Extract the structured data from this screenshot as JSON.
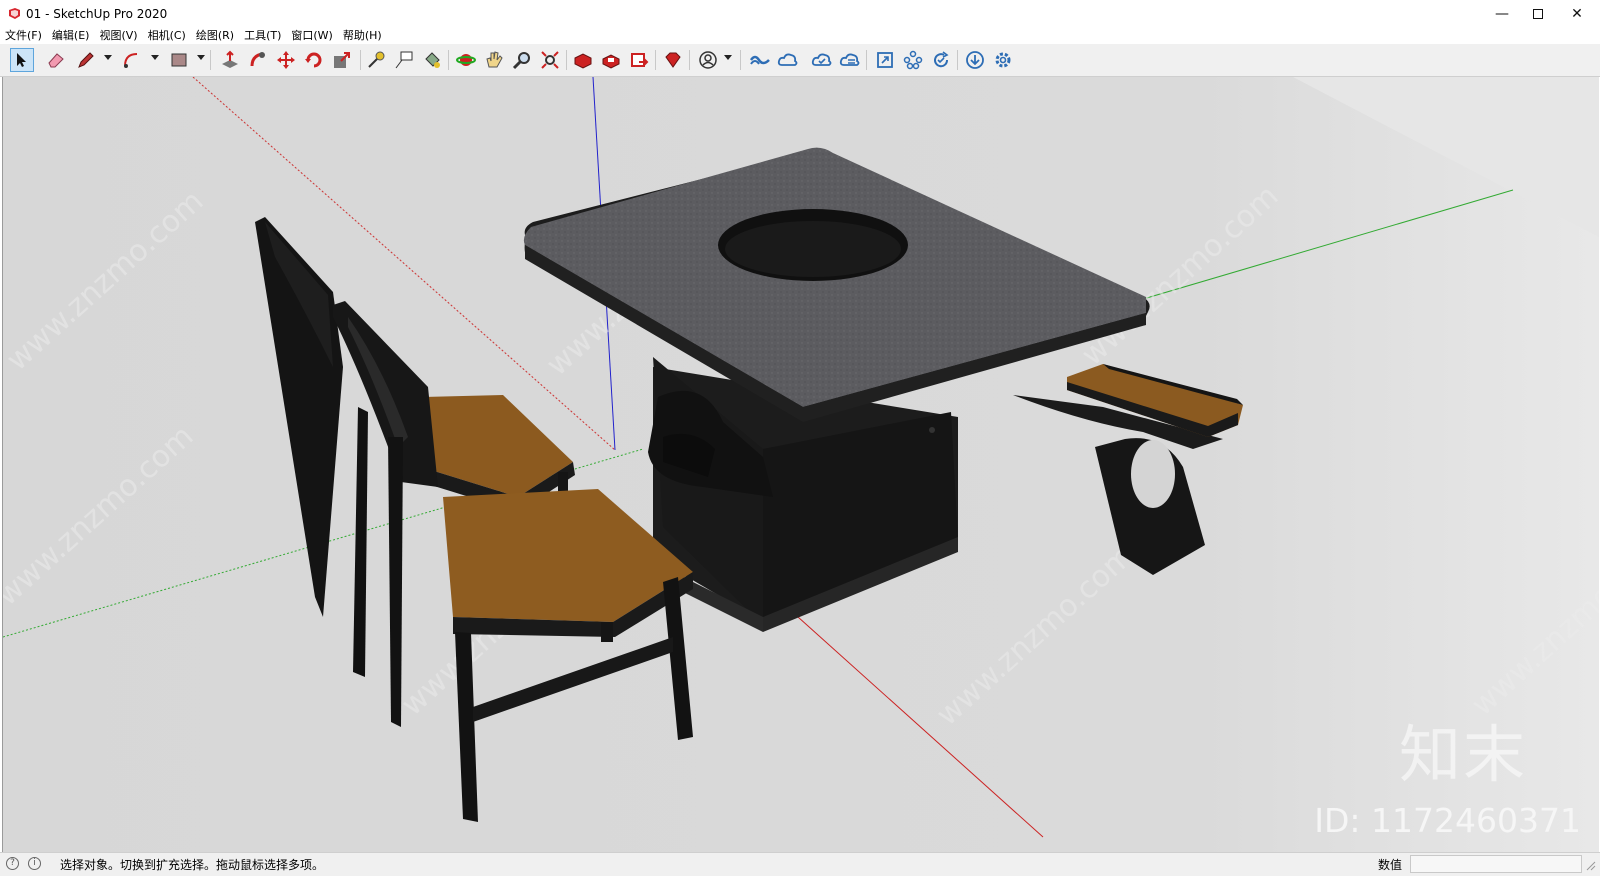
{
  "window": {
    "title": "01 - SketchUp Pro 2020",
    "controls": [
      "minimize-icon",
      "maximize-icon",
      "close-icon"
    ]
  },
  "menu": [
    "文件(F)",
    "编辑(E)",
    "视图(V)",
    "相机(C)",
    "绘图(R)",
    "工具(T)",
    "窗口(W)",
    "帮助(H)"
  ],
  "toolbar": {
    "active_tool": "select",
    "tools": [
      "select",
      "eraser",
      "line",
      "arc",
      "rectangle",
      "push-pull",
      "follow-me",
      "move",
      "rotate",
      "scale",
      "tape-measure",
      "text",
      "paint-bucket",
      "orbit",
      "pan",
      "zoom",
      "zoom-extents",
      "3d-warehouse",
      "extension-warehouse",
      "layout",
      "extension-manager",
      "profile",
      "trimble-connect",
      "collaborate",
      "add-location",
      "sync",
      "model-info",
      "components",
      "outliner",
      "download",
      "settings"
    ]
  },
  "viewport": {
    "watermark_text": "www.znzmo.com",
    "logo_text": "知末",
    "id_text": "ID: 1172460371",
    "colors": {
      "background": "#d9d9d9",
      "table_top": "#5a5a5d",
      "wood_seat": "#8a5a1e",
      "frame": "#1a1a1a",
      "red_axis": "#cc2222",
      "green_axis": "#33aa33",
      "blue_axis": "#2222cc"
    }
  },
  "status": {
    "hint": "选择对象。切换到扩充选择。拖动鼠标选择多项。",
    "measurements_label": "数值",
    "measurements_value": ""
  }
}
